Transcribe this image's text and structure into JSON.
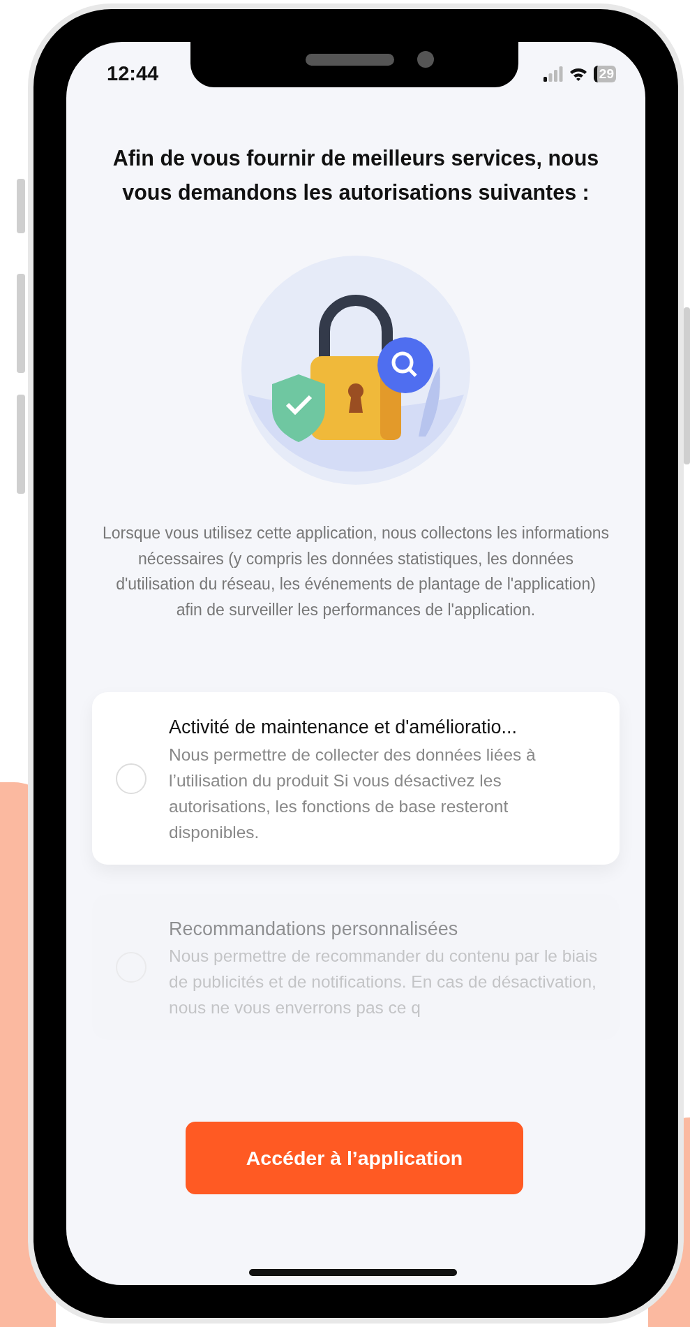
{
  "status_bar": {
    "time": "12:44",
    "battery": "29"
  },
  "title": "Afin de vous fournir de meilleurs services, nous vous demandons les autorisations suivantes :",
  "description": "Lorsque vous utilisez cette application, nous collectons les informations nécessaires (y compris les données statistiques, les données d'utilisation du réseau, les événements de plantage de l'application) afin de surveiller les performances de l'application.",
  "permissions": [
    {
      "title": "Activité de maintenance et d'amélioratio...",
      "description": "Nous permettre de collecter des données liées à l’utilisation du produit Si vous désactivez les autorisations, les fonctions de base resteront disponibles.",
      "checked": false,
      "disabled": false
    },
    {
      "title": "Recommandations personnalisées",
      "description": "Nous permettre de recommander du contenu par le biais de publicités et de notifications. En cas de désactivation, nous ne vous enverrons pas ce q",
      "checked": false,
      "disabled": true
    }
  ],
  "button": "Accéder à l’application"
}
